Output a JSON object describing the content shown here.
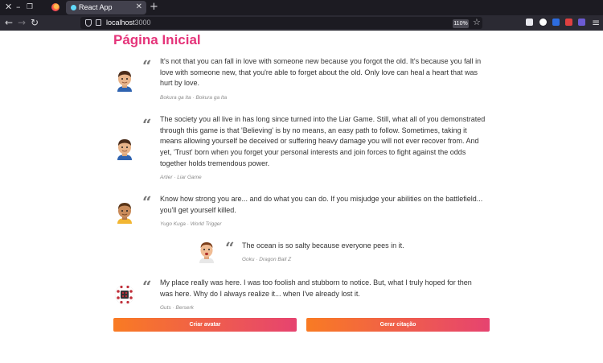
{
  "browser": {
    "tab_title": "React App",
    "tab_close": "✕",
    "new_tab": "+",
    "url_host": "localhost",
    "url_port": ":3000",
    "zoom": "110%",
    "minimize": "–",
    "close": "✕",
    "restore": "❐",
    "back": "←",
    "forward": "→",
    "reload": "↻",
    "bookmark": "☆"
  },
  "page": {
    "title": "Página Inicial"
  },
  "quotes": [
    {
      "mark": "“",
      "text": "It's not that you can fall in love with someone new because you forgot the old. It's because you fall in love with someone new, that you're able to forget about the old. Only love can heal a heart that was hurt by love.",
      "author": "Bokura ga Ita · Bokura ga Ita",
      "avatar": "boy-avatar-icon"
    },
    {
      "mark": "“",
      "text": "The society you all live in has long since turned into the Liar Game. Still, what all of you demonstrated through this game is that 'Believing' is by no means, an easy path to follow. Sometimes, taking it means allowing yourself be deceived or suffering heavy damage you will not ever recover from. And yet, 'Trust' born when you forget your personal interests and join forces to fight against the odds together holds tremendous power.",
      "author": "Artier · Liar Game",
      "avatar": "boy-avatar-icon"
    },
    {
      "mark": "“",
      "text": "Know how strong you are... and do what you can do. If you misjudge your abilities on the battlefield... you'll get yourself killed.",
      "author": "Yugo Kuga · World Trigger",
      "avatar": "tan-boy-avatar-icon"
    },
    {
      "mark": "“",
      "text": "The ocean is so salty because everyone pees in it.",
      "author": "Goku · Dragon Ball Z",
      "avatar": "surprised-boy-avatar-icon"
    },
    {
      "mark": "“",
      "text": "My place really was here. I was too foolish and stubborn to notice. But, what I truly hoped for then was here. Why do I always realize it... when I've already lost it.",
      "author": "Guts · Berserk",
      "avatar": "pattern-avatar-icon"
    }
  ],
  "actions": {
    "create_avatar": "Criar avatar",
    "generate_quote": "Gerar citação"
  },
  "colors": {
    "title": "#e5347a",
    "button_start": "#f97b23",
    "button_end": "#e64370",
    "chrome_dark": "#1c1b22",
    "chrome_toolbar": "#2b2a33"
  }
}
